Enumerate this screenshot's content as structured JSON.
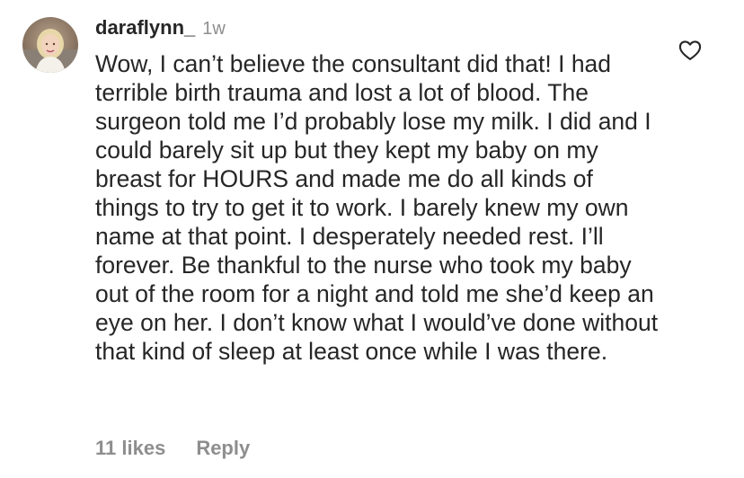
{
  "comment": {
    "username": "daraflynn_",
    "timestamp": "1w",
    "text": "Wow, I can’t believe the consultant did that! I had terrible birth trauma and lost a lot of blood. The surgeon told me I’d probably lose my milk. I did and I could barely sit up but they kept my baby on my breast for HOURS and made me do all kinds of things to try to get it to work. I barely knew my own name at that point. I desperately needed rest. I’ll forever. Be thankful to the nurse who took my baby out of the room for a night and told me she’d keep an eye on her. I don’t know what I would’ve done without that kind of sleep at least once while I was there.",
    "likes_label": "11 likes",
    "reply_label": "Reply",
    "like_icon": "heart-outline-icon",
    "avatar_icon": "user-avatar-photo"
  },
  "colors": {
    "primary_text": "#262626",
    "secondary_text": "#8e8e8e",
    "background": "#ffffff"
  }
}
